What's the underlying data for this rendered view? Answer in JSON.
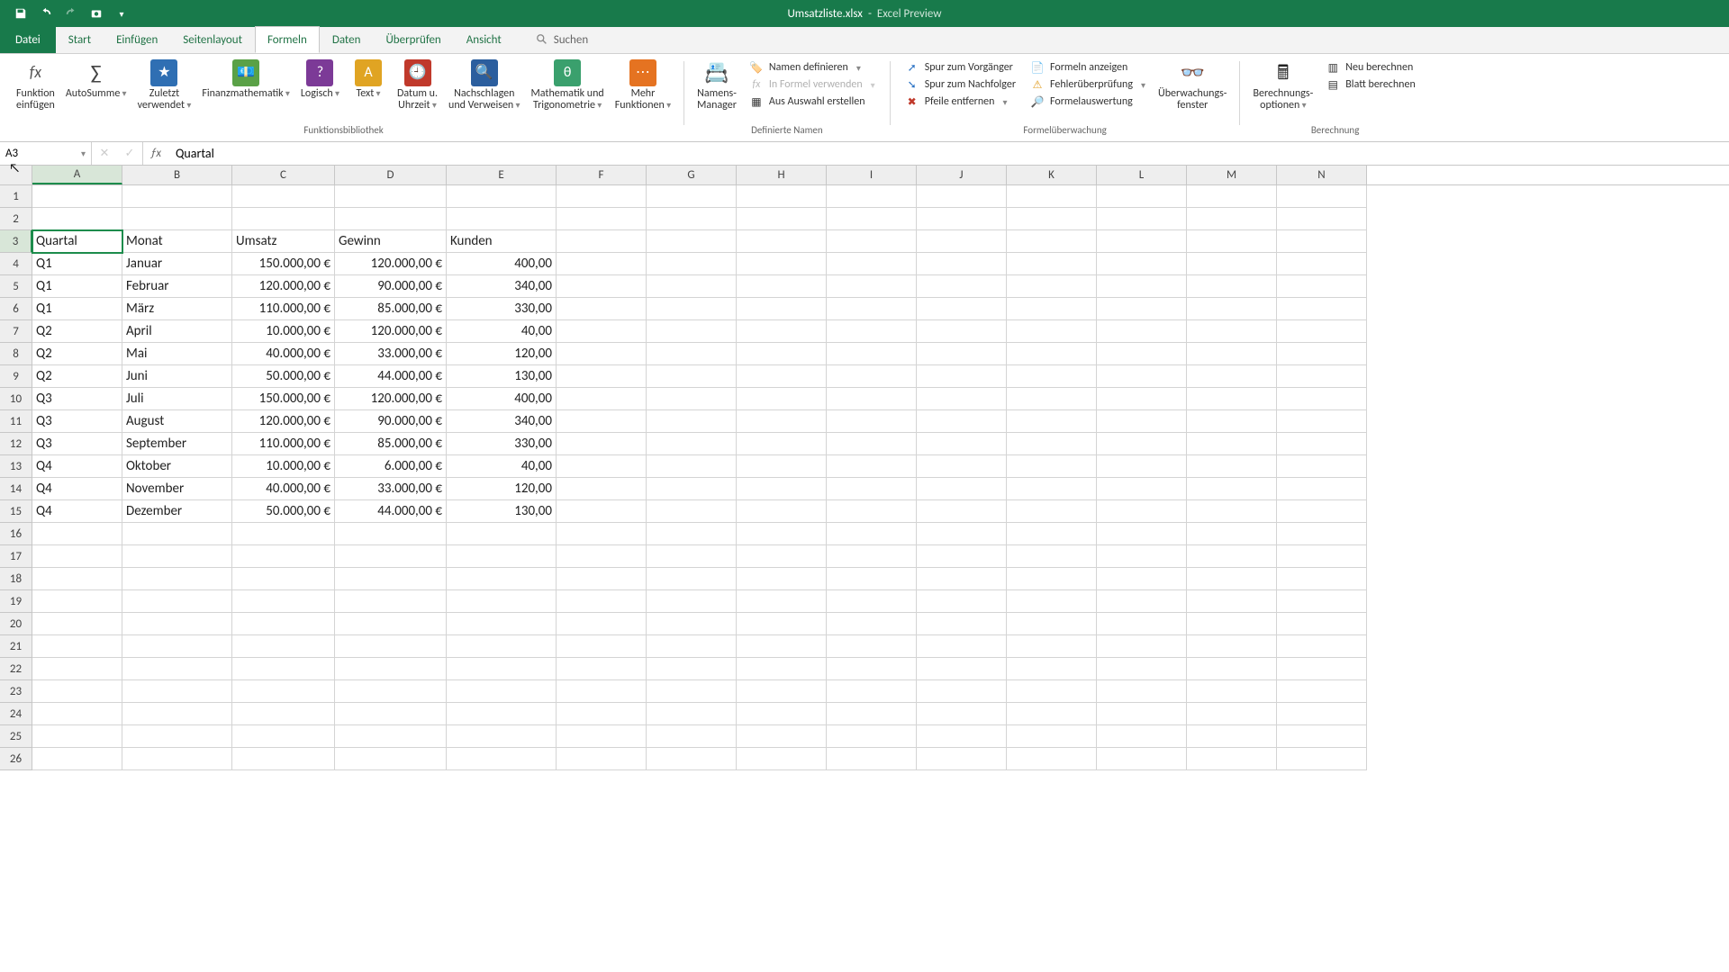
{
  "titlebar": {
    "filename": "Umsatzliste.xlsx",
    "appname": "Excel Preview"
  },
  "tabs": {
    "file": "Datei",
    "items": [
      "Start",
      "Einfügen",
      "Seitenlayout",
      "Formeln",
      "Daten",
      "Überprüfen",
      "Ansicht"
    ],
    "active_index": 3,
    "search_label": "Suchen"
  },
  "ribbon": {
    "function_library": {
      "insert_fn": "Funktion\neinfügen",
      "autosum": "AutoSumme",
      "recent": "Zuletzt\nverwendet",
      "financial": "Finanzmathematik",
      "logical": "Logisch",
      "text": "Text",
      "date": "Datum u.\nUhrzeit",
      "lookup": "Nachschlagen\nund Verweisen",
      "math": "Mathematik und\nTrigonometrie",
      "more": "Mehr\nFunktionen",
      "group": "Funktionsbibliothek"
    },
    "defined_names": {
      "name_mgr": "Namens-\nManager",
      "define": "Namen definieren",
      "use_in": "In Formel verwenden",
      "create_sel": "Aus Auswahl erstellen",
      "group": "Definierte Namen"
    },
    "audit": {
      "trace_prec": "Spur zum Vorgänger",
      "trace_dep": "Spur zum Nachfolger",
      "remove_arrows": "Pfeile entfernen",
      "show_formulas": "Formeln anzeigen",
      "error_check": "Fehlerüberprüfung",
      "eval": "Formelauswertung",
      "watch": "Überwachungs-\nfenster",
      "group": "Formelüberwachung"
    },
    "calc": {
      "options": "Berechnungs-\noptionen",
      "now": "Neu berechnen",
      "sheet": "Blatt berechnen",
      "group": "Berechnung"
    }
  },
  "namebox": {
    "value": "A3"
  },
  "formula_bar": {
    "value": "Quartal"
  },
  "columns": [
    "A",
    "B",
    "C",
    "D",
    "E",
    "F",
    "G",
    "H",
    "I",
    "J",
    "K",
    "L",
    "M",
    "N"
  ],
  "col_widths": {
    "A": "colA",
    "B": "colB",
    "C": "colC",
    "D": "colD",
    "E": "colE",
    "F": "colF",
    "G": "colG",
    "H": "colH",
    "I": "colI",
    "J": "colJ",
    "K": "colK",
    "L": "colL",
    "M": "colM",
    "N": "colN"
  },
  "selected_col": "A",
  "selected_row": 3,
  "row_count": 26,
  "sheet": {
    "headers_row": 3,
    "headers": [
      "Quartal",
      "Monat",
      "Umsatz",
      "Gewinn",
      "Kunden"
    ],
    "data_start_row": 4,
    "rows": [
      {
        "q": "Q1",
        "m": "Januar",
        "u": "150.000,00 €",
        "g": "120.000,00 €",
        "k": "400,00"
      },
      {
        "q": "Q1",
        "m": "Februar",
        "u": "120.000,00 €",
        "g": "90.000,00 €",
        "k": "340,00"
      },
      {
        "q": "Q1",
        "m": "März",
        "u": "110.000,00 €",
        "g": "85.000,00 €",
        "k": "330,00"
      },
      {
        "q": "Q2",
        "m": "April",
        "u": "10.000,00 €",
        "g": "120.000,00 €",
        "k": "40,00"
      },
      {
        "q": "Q2",
        "m": "Mai",
        "u": "40.000,00 €",
        "g": "33.000,00 €",
        "k": "120,00"
      },
      {
        "q": "Q2",
        "m": "Juni",
        "u": "50.000,00 €",
        "g": "44.000,00 €",
        "k": "130,00"
      },
      {
        "q": "Q3",
        "m": "Juli",
        "u": "150.000,00 €",
        "g": "120.000,00 €",
        "k": "400,00"
      },
      {
        "q": "Q3",
        "m": "August",
        "u": "120.000,00 €",
        "g": "90.000,00 €",
        "k": "340,00"
      },
      {
        "q": "Q3",
        "m": "September",
        "u": "110.000,00 €",
        "g": "85.000,00 €",
        "k": "330,00"
      },
      {
        "q": "Q4",
        "m": "Oktober",
        "u": "10.000,00 €",
        "g": "6.000,00 €",
        "k": "40,00"
      },
      {
        "q": "Q4",
        "m": "November",
        "u": "40.000,00 €",
        "g": "33.000,00 €",
        "k": "120,00"
      },
      {
        "q": "Q4",
        "m": "Dezember",
        "u": "50.000,00 €",
        "g": "44.000,00 €",
        "k": "130,00"
      }
    ]
  }
}
